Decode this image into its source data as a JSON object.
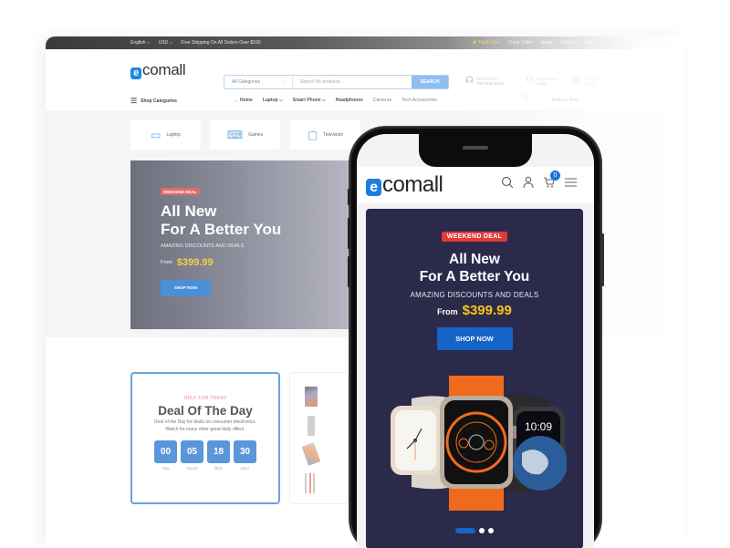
{
  "desktop": {
    "topbar": {
      "language": "English ⌵",
      "currency": "USD ⌵",
      "shipping": "Free Shipping On All Orders Over $100",
      "links": [
        "⚡ Flash Sale",
        "Track Order",
        "About",
        "Contact",
        "Blog"
      ]
    },
    "header": {
      "logo_e": "e",
      "logo_text": "comall",
      "search": {
        "category": "All Categories",
        "placeholder": "Search for products",
        "button": "SEARCH"
      },
      "support": {
        "label": "Need Help?",
        "phone": "+00 9128 8228"
      },
      "account": {
        "label": "My Account",
        "value": "Login"
      },
      "cart": {
        "label": "My Cart",
        "value": "$0.00"
      }
    },
    "nav": {
      "shop_categories": "Shop Categories",
      "links": [
        "Home",
        "Laptop ⌵",
        "Smart Phone ⌵",
        "Headphones",
        "Cameras",
        "Tech Accessories"
      ],
      "todays_deal": "Today's Deal"
    },
    "categories": [
      {
        "icon": "laptop-icon",
        "glyph": "▭",
        "label": "Laptop"
      },
      {
        "icon": "gamepad-icon",
        "glyph": "⌨",
        "label": "Games"
      },
      {
        "icon": "television-icon",
        "glyph": "▢",
        "label": "Television"
      }
    ],
    "hero": {
      "badge": "WEEKEND DEAL",
      "title_line1": "All New",
      "title_line2": "For A Better You",
      "subtitle": "AMAZING DISCOUNTS AND DEALS",
      "from": "From",
      "price": "$399.99",
      "button": "SHOP NOW"
    },
    "deal": {
      "eyebrow": "ONLY FOR TODAY",
      "title": "Deal Of The Day",
      "desc_line1": "Deal of the Day for deals on consumer electronics.",
      "desc_line2": "Watch for many other great daily offers.",
      "timer": [
        {
          "value": "00",
          "label": "Day"
        },
        {
          "value": "05",
          "label": "Hours"
        },
        {
          "value": "18",
          "label": "Mins"
        },
        {
          "value": "30",
          "label": "Secs"
        }
      ]
    }
  },
  "mobile": {
    "logo_e": "e",
    "logo_text": "comall",
    "cart_count": "0",
    "hero": {
      "badge": "WEEKEND DEAL",
      "title_line1": "All New",
      "title_line2": "For A Better You",
      "subtitle": "AMAZING DISCOUNTS AND DEALS",
      "from": "From",
      "price": "$399.99",
      "button": "SHOP NOW",
      "watch_time": "10:09",
      "slides": 3,
      "active_slide": 1
    }
  }
}
